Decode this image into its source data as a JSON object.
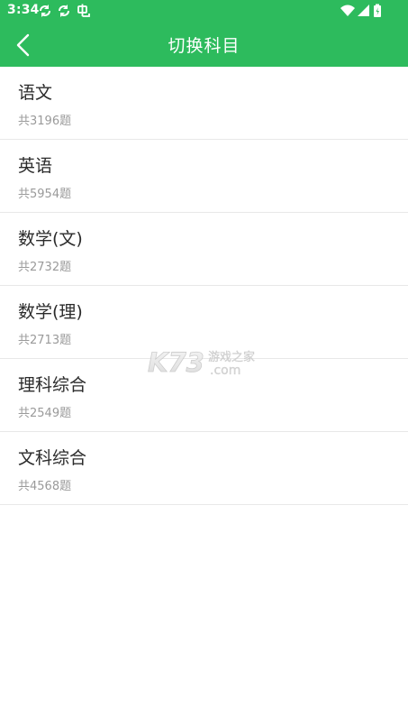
{
  "status_bar": {
    "time": "3:34",
    "left_icons": [
      "sync-icon",
      "sync-icon",
      "notification-icon"
    ],
    "right_icons": [
      "wifi-icon",
      "signal-icon",
      "battery-icon"
    ]
  },
  "toolbar": {
    "back_icon": "chevron-left-icon",
    "title": "切换科目"
  },
  "colors": {
    "header_bg": "#2dbb5d",
    "title_text": "#ffffff",
    "item_text": "#2b2b2b",
    "count_text": "#9a9a9a",
    "divider": "#e8e8e8"
  },
  "subjects": [
    {
      "name": "语文",
      "count": "共3196题"
    },
    {
      "name": "英语",
      "count": "共5954题"
    },
    {
      "name": "数学(文)",
      "count": "共2732题"
    },
    {
      "name": "数学(理)",
      "count": "共2713题"
    },
    {
      "name": "理科综合",
      "count": "共2549题"
    },
    {
      "name": "文科综合",
      "count": "共4568题"
    }
  ],
  "watermark": {
    "brand": "K73",
    "line1": "游戏之家",
    "line2": ".com"
  }
}
